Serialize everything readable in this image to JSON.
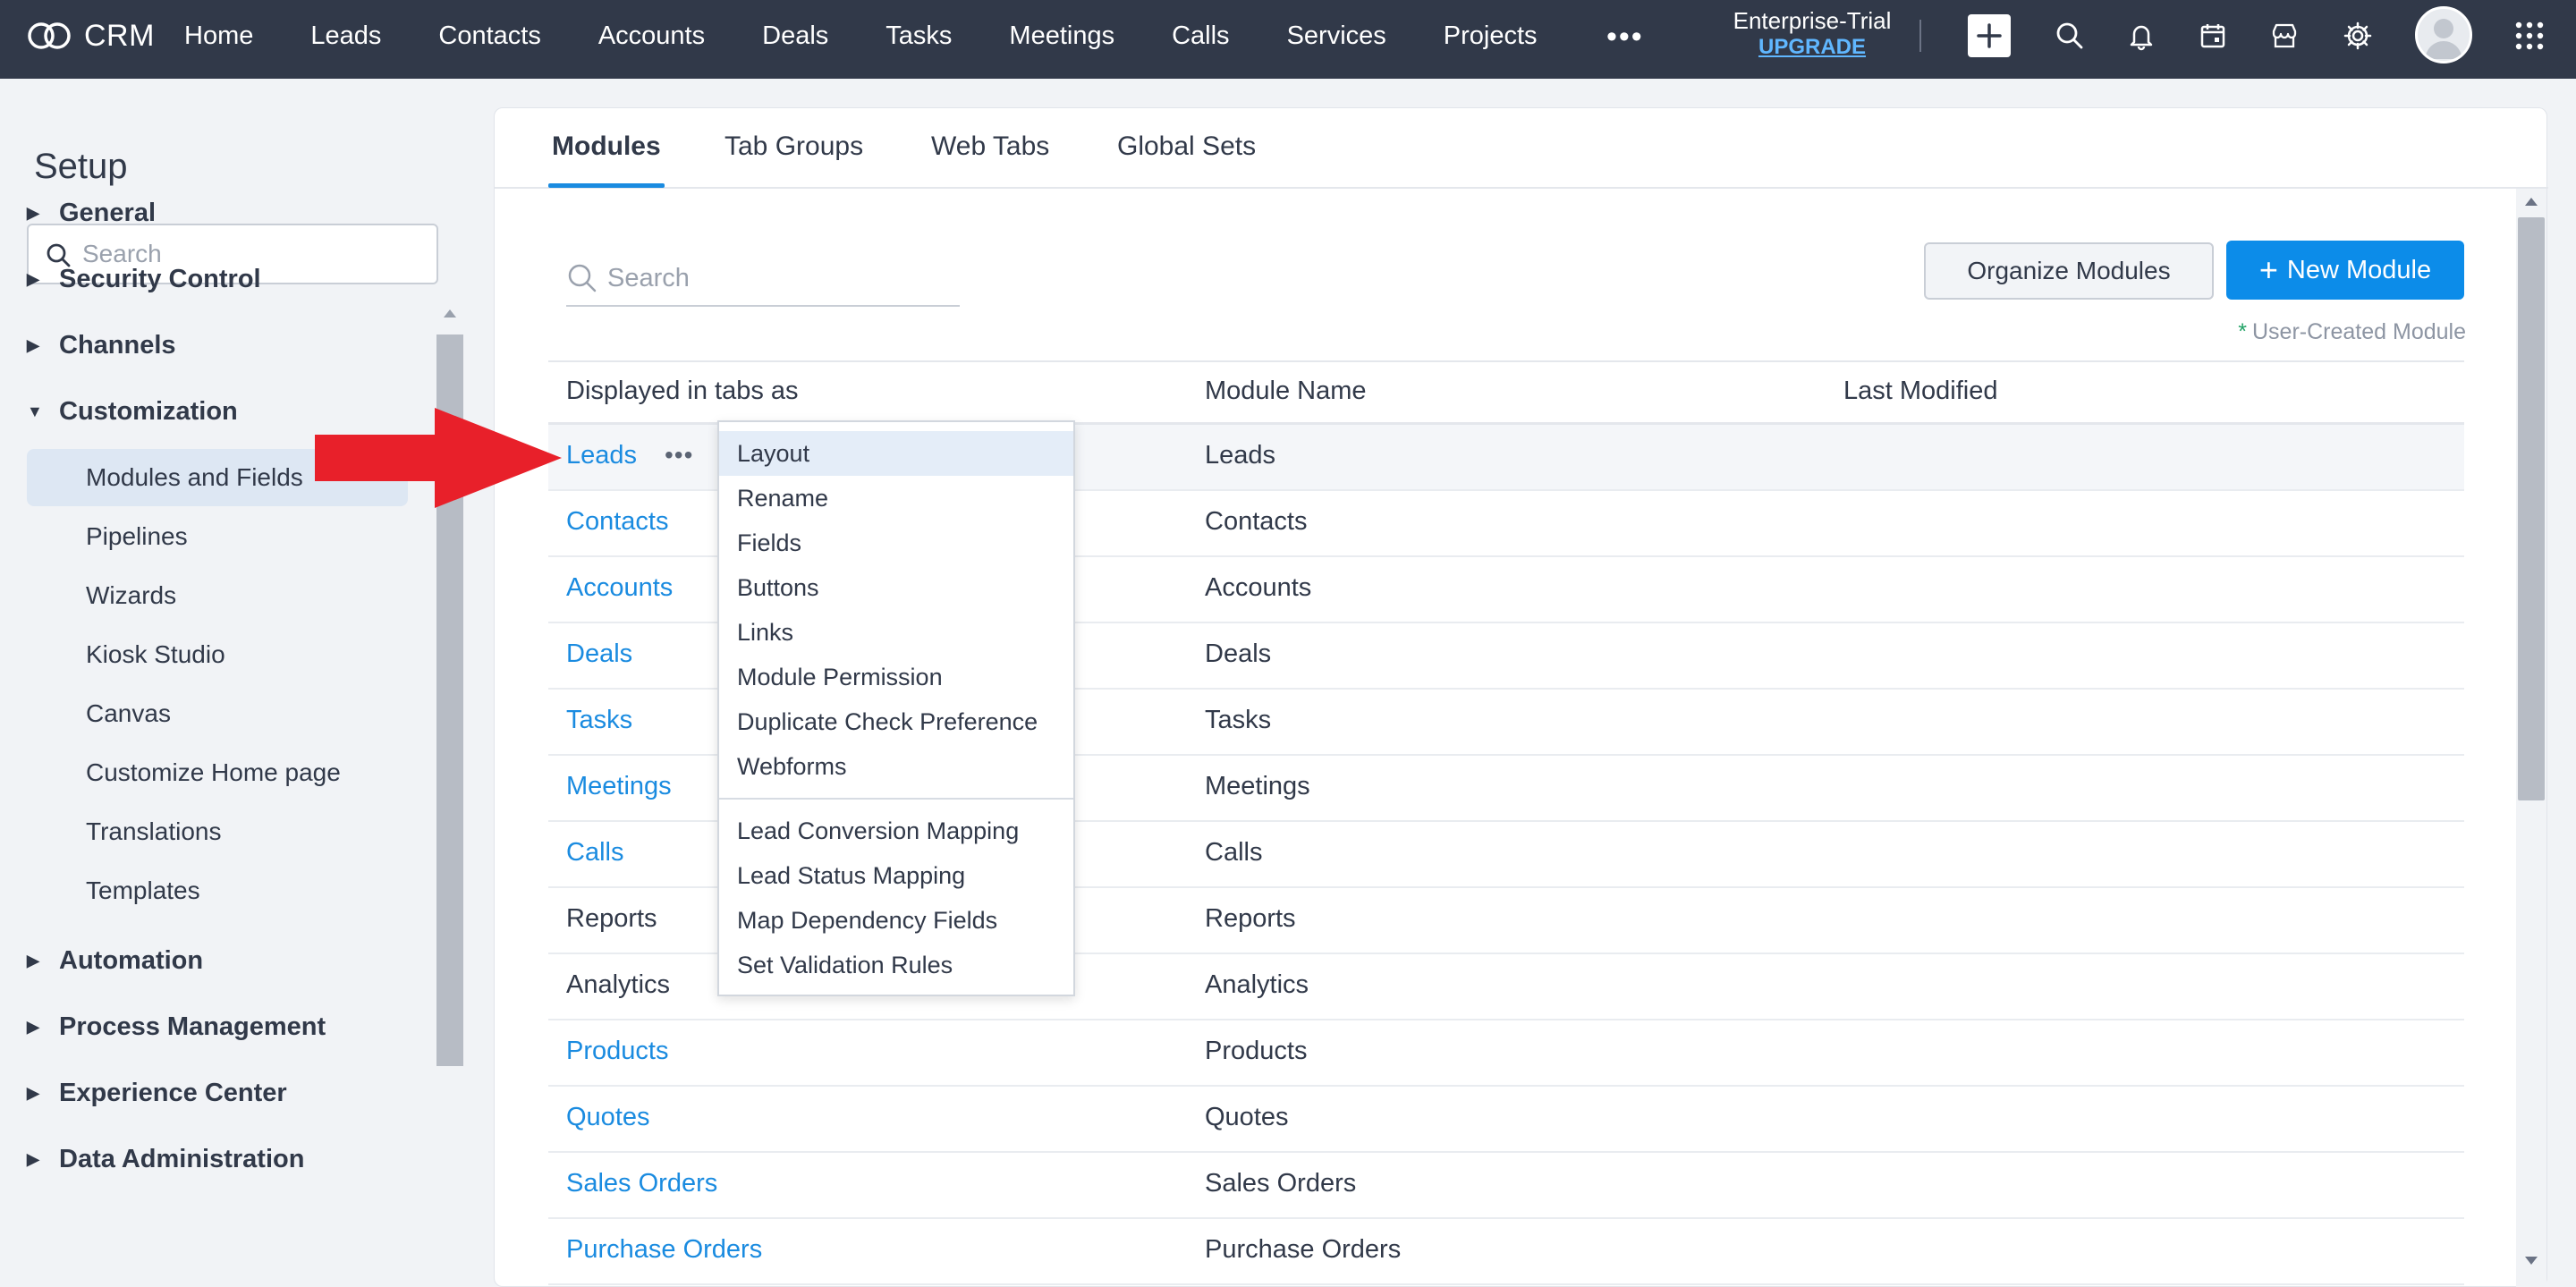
{
  "topbar": {
    "brand": "CRM",
    "nav": [
      "Home",
      "Leads",
      "Contacts",
      "Accounts",
      "Deals",
      "Tasks",
      "Meetings",
      "Calls",
      "Services",
      "Projects"
    ],
    "more_icon": "more-horizontal-icon",
    "trial_label": "Enterprise-Trial",
    "upgrade_label": "UPGRADE",
    "icons": [
      "plus-icon",
      "search-icon",
      "bell-icon",
      "calendar-icon",
      "marketplace-icon",
      "gear-icon",
      "avatar",
      "apps-grid-icon"
    ]
  },
  "sidebar": {
    "title": "Setup",
    "search_placeholder": "Search",
    "sections": [
      {
        "label": "General",
        "expanded": false
      },
      {
        "label": "Security Control",
        "expanded": false
      },
      {
        "label": "Channels",
        "expanded": false
      },
      {
        "label": "Customization",
        "expanded": true
      },
      {
        "label": "Automation",
        "expanded": false
      },
      {
        "label": "Process Management",
        "expanded": false
      },
      {
        "label": "Experience Center",
        "expanded": false
      },
      {
        "label": "Data Administration",
        "expanded": false
      }
    ],
    "customization_items": [
      "Modules and Fields",
      "Pipelines",
      "Wizards",
      "Kiosk Studio",
      "Canvas",
      "Customize Home page",
      "Translations",
      "Templates"
    ],
    "active_item": "Modules and Fields"
  },
  "main": {
    "tabs": [
      "Modules",
      "Tab Groups",
      "Web Tabs",
      "Global Sets"
    ],
    "active_tab": "Modules",
    "search_placeholder": "Search",
    "organize_button": "Organize Modules",
    "new_module_button": "New Module",
    "legend_star": "*",
    "legend_text": "User-Created Module",
    "columns": [
      "Displayed in tabs as",
      "Module Name",
      "Last Modified"
    ],
    "rows": [
      {
        "tab": "Leads",
        "name": "Leads",
        "link": true
      },
      {
        "tab": "Contacts",
        "name": "Contacts",
        "link": true
      },
      {
        "tab": "Accounts",
        "name": "Accounts",
        "link": true
      },
      {
        "tab": "Deals",
        "name": "Deals",
        "link": true
      },
      {
        "tab": "Tasks",
        "name": "Tasks",
        "link": true
      },
      {
        "tab": "Meetings",
        "name": "Meetings",
        "link": true
      },
      {
        "tab": "Calls",
        "name": "Calls",
        "link": true
      },
      {
        "tab": "Reports",
        "name": "Reports",
        "link": false
      },
      {
        "tab": "Analytics",
        "name": "Analytics",
        "link": false
      },
      {
        "tab": "Products",
        "name": "Products",
        "link": true
      },
      {
        "tab": "Quotes",
        "name": "Quotes",
        "link": true
      },
      {
        "tab": "Sales Orders",
        "name": "Sales Orders",
        "link": true
      },
      {
        "tab": "Purchase Orders",
        "name": "Purchase Orders",
        "link": true
      }
    ],
    "row_more": "•••"
  },
  "dropdown": {
    "group1": [
      "Layout",
      "Rename",
      "Fields",
      "Buttons",
      "Links",
      "Module Permission",
      "Duplicate Check Preference",
      "Webforms"
    ],
    "group2": [
      "Lead Conversion Mapping",
      "Lead Status Mapping",
      "Map Dependency Fields",
      "Set Validation Rules"
    ],
    "active_item": "Layout"
  },
  "colors": {
    "topbar": "#313949",
    "accent": "#0c8ce9",
    "link": "#1a8be0",
    "annotation_arrow": "#e8202a"
  }
}
